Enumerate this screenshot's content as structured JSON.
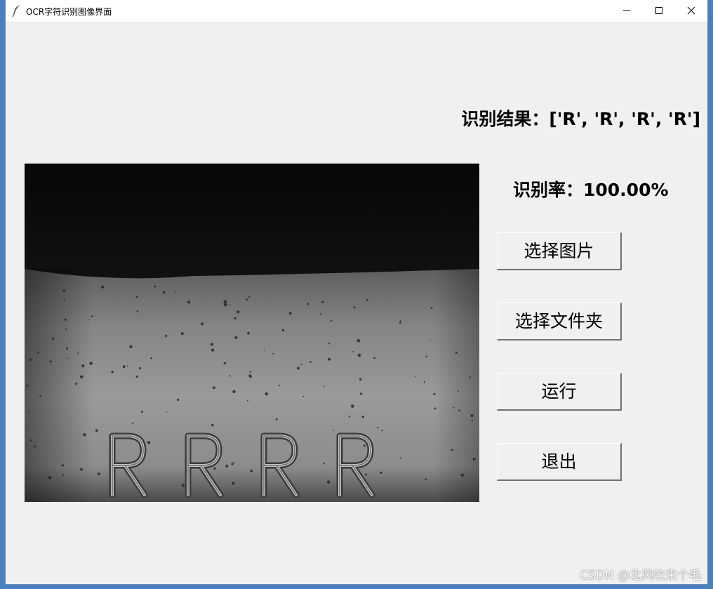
{
  "window": {
    "title": "OCR字符识别图像界面",
    "app_icon": "feather-icon",
    "controls": [
      "minimize-icon",
      "maximize-icon",
      "close-icon"
    ]
  },
  "result": {
    "text": "识别结果：['R', 'R', 'R', 'R']"
  },
  "rate": {
    "text": "识别率：100.00%"
  },
  "image": {
    "characters": [
      "R",
      "R",
      "R",
      "R"
    ]
  },
  "buttons": {
    "select_image": "选择图片",
    "select_folder": "选择文件夹",
    "run": "运行",
    "exit": "退出"
  },
  "watermark": "CSDN @北风吹来个毛",
  "colors": {
    "window_bg": "#f0f0f0",
    "titlebar_bg": "#ffffff",
    "desktop_bg": "#4a7fc0"
  }
}
